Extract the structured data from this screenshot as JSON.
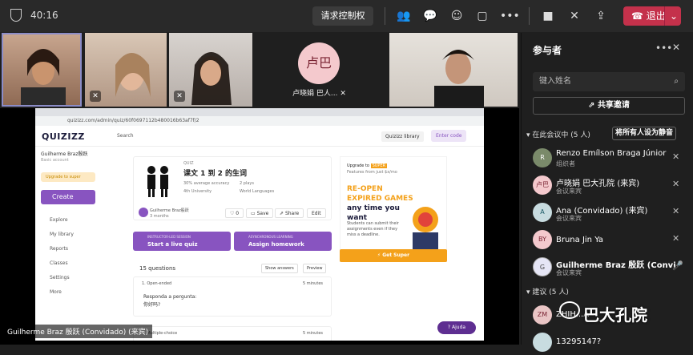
{
  "topbar": {
    "timer": "40:16",
    "request_control": "请求控制权",
    "leave": "退出"
  },
  "videos": {
    "avatar_initials": "卢巴",
    "avatar_name": "卢晓娟 巴人..."
  },
  "share": {
    "presenter_label": "Guilherme Braz 殷跃 (Convidado) (来宾)",
    "url": "quizizz.com/admin/quiz/60f0697112b480016b63af7f/2",
    "app": {
      "logo": "QUIZIZZ",
      "search_placeholder": "Search",
      "library": "Quizizz library",
      "enter_code": "Enter code",
      "user": "Guilherme Braz殷跃",
      "user_sub": "Basic account",
      "upgrade": "Upgrade to super",
      "create": "Create",
      "nav": [
        "Explore",
        "My library",
        "Reports",
        "Classes",
        "Settings",
        "More"
      ],
      "quiz": {
        "type": "QUIZ",
        "title": "课文 1 到 2 的生词",
        "accuracy": "30% average accuracy",
        "plays": "2 plays",
        "grade": "4th University",
        "subject": "World Languages",
        "author": "Guilherme Braz殷跃",
        "author_time": "3 months",
        "likes": "0",
        "save": "Save",
        "share": "Share",
        "edit": "Edit"
      },
      "live_sub": "INSTRUCTOR-LED SESSION",
      "live": "Start a live quiz",
      "hw_sub": "ASYNCHRONOUS LEARNING",
      "hw": "Assign homework",
      "questions_count": "15 questions",
      "show_answers": "Show answers",
      "preview": "Preview",
      "q1_head": "1. Open-ended",
      "q1_time": "5 minutes",
      "q1_line1": "Responda a pergunta:",
      "q1_line2": "你好吗?",
      "q2_head": "2. Multiple-choice",
      "q2_time": "5 minutes",
      "ad_upgrade": "Upgrade to",
      "ad_super": "SUPER",
      "ad_note": "Features from just $x/mo",
      "ad_h1": "RE-OPEN EXPIRED",
      "ad_h2": "GAMES",
      "ad_h3": "any time you want",
      "ad_p": "Students can submit their assignments even if they miss a deadline.",
      "get_super": "Get Super",
      "help": "Ajuda"
    }
  },
  "panel": {
    "title": "参与者",
    "search_placeholder": "键入姓名",
    "share_invite": "共享邀请",
    "in_meeting": "在此会议中 (5 人)",
    "mute_all": "将所有人设为静音",
    "participants": [
      {
        "name": "Renzo Emílson Braga Júnior",
        "role": "组织者",
        "initials": "R"
      },
      {
        "name": "卢晓娟 巴大孔院 (来宾)",
        "role": "会议来宾",
        "initials": "卢巴"
      },
      {
        "name": "Ana (Convidado) (来宾)",
        "role": "会议来宾",
        "initials": "A"
      },
      {
        "name": "Bruna Jin Ya",
        "role": "",
        "initials": "BY"
      },
      {
        "name": "Guilherme Braz 殷跃 (Convid...",
        "role": "会议来宾",
        "initials": "G"
      }
    ],
    "suggested": "建议 (5 人)",
    "suggested_people": [
      {
        "name": "ZHIH...A",
        "initials": "ZM"
      },
      {
        "name": "13295147?",
        "initials": ""
      }
    ]
  },
  "watermark": "巴大孔院"
}
